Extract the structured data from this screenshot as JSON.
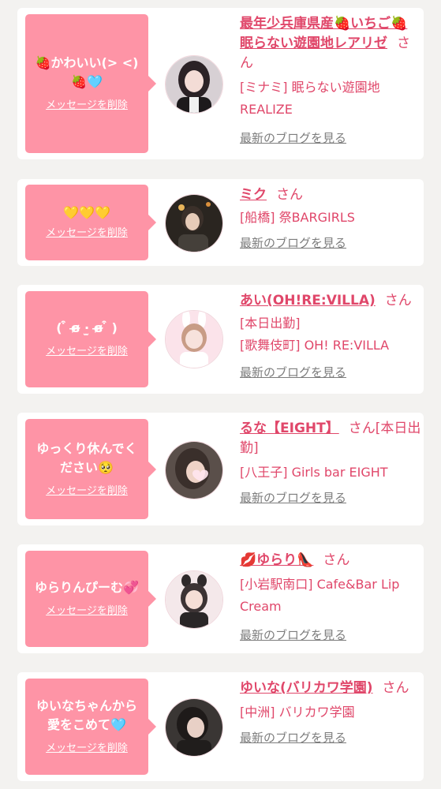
{
  "delete_label": "メッセージを削除",
  "blog_label": "最新のブログを見る",
  "cards": [
    {
      "message": "🍓かわいい(> <)🍓🩵",
      "name": "最年少兵庫県産🍓いちご🍓 眠らない遊園地レアリゼ",
      "suffix": "さん",
      "shop_lines": [
        "[ミナミ] 眠らない遊園地REALIZE"
      ]
    },
    {
      "message": "💛💛💛",
      "name": "ミク",
      "suffix": "さん",
      "shop_lines": [
        "[船橋] 祭BARGIRLS"
      ]
    },
    {
      "message": "( ͒ ɞ̴̶̷ ·̫ ɞ̴̶̷ ͒ )",
      "name": "あい(OH!RE:VILLA)",
      "suffix": "さん",
      "shop_lines": [
        "[本日出勤]",
        "[歌舞伎町] OH! RE:VILLA"
      ]
    },
    {
      "message": "ゆっくり休んでください🥺",
      "name": "るな【EIGHT】",
      "suffix": "さん[本日出勤]",
      "shop_lines": [
        "[八王子] Girls bar EIGHT"
      ]
    },
    {
      "message": "ゆらりんぴーむ💞",
      "name": "💋ゆらり👠",
      "suffix": "さん",
      "shop_lines": [
        "[小岩駅南口] Cafe&Bar Lip Cream"
      ]
    },
    {
      "message": "ゆいなちゃんから愛をこめて🩵",
      "name": "ゆいな(バリカワ学園)",
      "suffix": "さん",
      "shop_lines": [
        "[中洲] バリカワ学園"
      ]
    }
  ]
}
